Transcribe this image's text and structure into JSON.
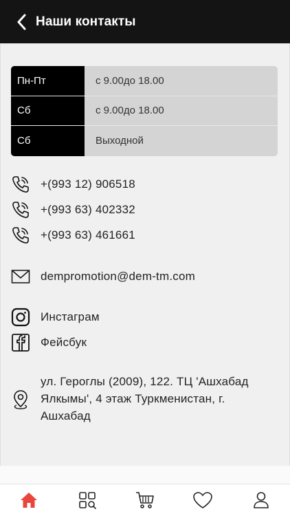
{
  "header": {
    "title": "Наши контакты"
  },
  "hours": [
    {
      "day": "Пн-Пт",
      "time": "с 9.00до 18.00"
    },
    {
      "day": "Сб",
      "time": "с 9.00до 18.00"
    },
    {
      "day": "Сб",
      "time": "Выходной"
    }
  ],
  "phones": [
    "+(993 12) 906518",
    "+(993 63) 402332",
    "+(993 63) 461661"
  ],
  "email": "dempromotion@dem-tm.com",
  "social": {
    "instagram": "Инстаграм",
    "facebook": "Фейсбук"
  },
  "address": "ул. Героглы (2009), 122. ТЦ 'Ашхабад Ялкымы', 4 этаж Туркменистан, г. Ашхабад",
  "colors": {
    "header_bg": "#141414",
    "accent": "#e8453c",
    "day_bg": "#000000",
    "time_bg": "#d4d4d4"
  },
  "tabs": [
    {
      "icon": "home-icon",
      "active": true
    },
    {
      "icon": "catalog-icon",
      "active": false
    },
    {
      "icon": "cart-icon",
      "active": false
    },
    {
      "icon": "heart-icon",
      "active": false
    },
    {
      "icon": "profile-icon",
      "active": false
    }
  ]
}
